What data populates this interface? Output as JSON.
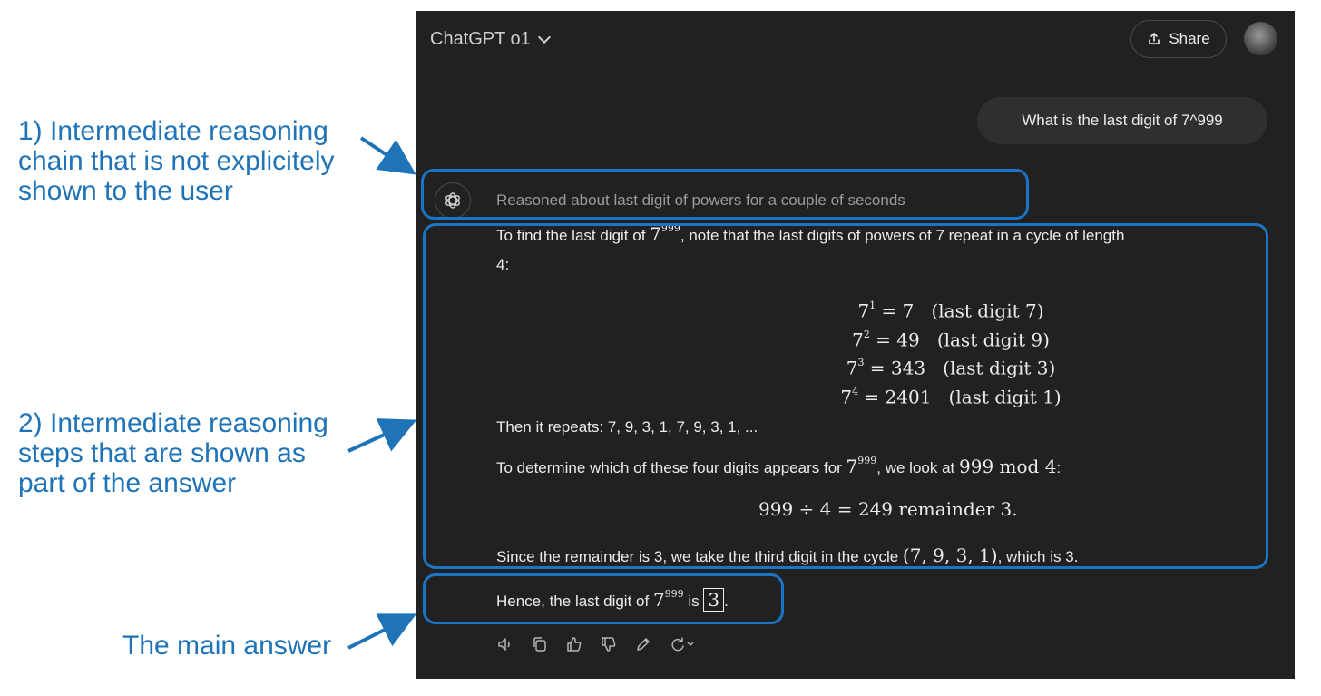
{
  "annotations": {
    "a1": [
      "1) Intermediate reasoning",
      "chain that is not explicitely",
      "shown to the user"
    ],
    "a2": [
      "2) Intermediate reasoning",
      "steps that are shown as",
      "part of the answer"
    ],
    "a3": "The main answer"
  },
  "header": {
    "title": "ChatGPT o1",
    "share_label": "Share"
  },
  "user_message": "What is the last digit of 7^999",
  "reasoning_summary": "Reasoned about last digit of powers for a couple of seconds",
  "answer": {
    "intro_pre": "To find the last digit of ",
    "intro_base": "7",
    "intro_exp": "999",
    "intro_post": ", note that the last digits of powers of 7 repeat in a cycle of length",
    "intro_line2": "4:",
    "equations": [
      {
        "base": "7",
        "exp": "1",
        "rhs": " = 7",
        "note": "(last digit 7)"
      },
      {
        "base": "7",
        "exp": "2",
        "rhs": " = 49",
        "note": "(last digit 9)"
      },
      {
        "base": "7",
        "exp": "3",
        "rhs": " = 343",
        "note": "(last digit 3)"
      },
      {
        "base": "7",
        "exp": "4",
        "rhs": " = 2401",
        "note": "(last digit 1)"
      }
    ],
    "repeat_line": "Then it repeats: 7, 9, 3, 1, 7, 9, 3, 1, ...",
    "determine_pre": "To determine which of these four digits appears for ",
    "determine_base": "7",
    "determine_exp": "999",
    "determine_mid": ", we look at ",
    "determine_math": "999 mod 4",
    "determine_post": ":",
    "division": "999 ÷ 4 = 249 remainder 3.",
    "since_pre": "Since the remainder is 3, we take the third digit in the cycle ",
    "since_math": "(7, 9, 3, 1)",
    "since_post": ", which is 3.",
    "hence_pre": "Hence, the last digit of ",
    "hence_base": "7",
    "hence_exp": "999",
    "hence_mid": " is ",
    "hence_box": "3",
    "hence_post": "."
  },
  "toolbar_icons": [
    "speaker-icon",
    "copy-icon",
    "thumbs-up-icon",
    "thumbs-down-icon",
    "edit-icon",
    "regenerate-icon"
  ],
  "colors": {
    "panel": "#212121",
    "annotation": "#1f73b7",
    "highlight": "#1b75c6",
    "bubble": "#2f2f2f"
  }
}
